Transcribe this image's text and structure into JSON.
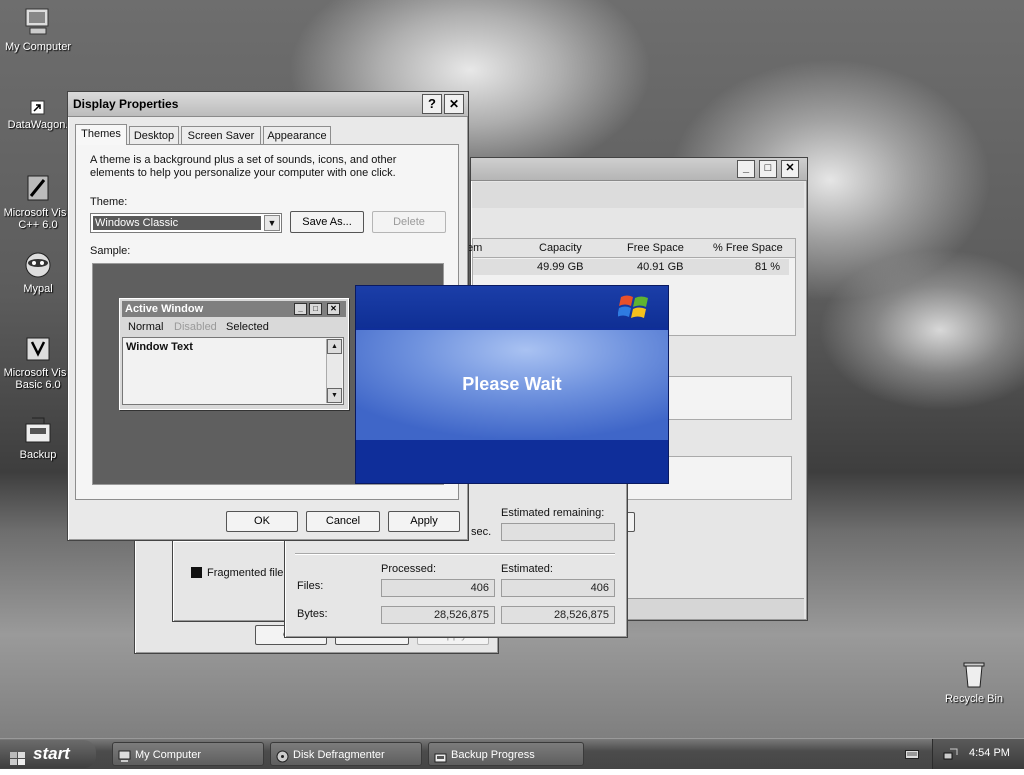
{
  "desktop": {
    "icons": [
      {
        "label": "My Computer",
        "icon": "my-computer-icon"
      },
      {
        "label": "DataWagon.",
        "icon": "shortcut-icon"
      },
      {
        "label": "Microsoft Visu C++ 6.0",
        "icon": "visual-cpp-icon"
      },
      {
        "label": "Mypal",
        "icon": "mypal-icon"
      },
      {
        "label": "Microsoft Visu Basic 6.0",
        "icon": "visual-basic-icon"
      },
      {
        "label": "Backup",
        "icon": "backup-icon"
      },
      {
        "label": "Recycle Bin",
        "icon": "recycle-bin-icon"
      }
    ]
  },
  "display_properties": {
    "title": "Display Properties",
    "help": "?",
    "close": "✕",
    "tabs": [
      "Themes",
      "Desktop",
      "Screen Saver",
      "Appearance"
    ],
    "description": "A theme is a background plus a set of sounds, icons, and other elements to help you personalize your computer with one click.",
    "theme_label": "Theme:",
    "theme_value": "Windows Classic",
    "save_as": "Save As...",
    "delete": "Delete",
    "sample_label": "Sample:",
    "sample": {
      "title": "Active Window",
      "menu": [
        "Normal",
        "Disabled",
        "Selected"
      ],
      "text": "Window Text"
    },
    "ok": "OK",
    "cancel": "Cancel",
    "apply": "Apply"
  },
  "disk_window": {
    "columns": [
      "em",
      "Capacity",
      "Free Space",
      "% Free Space"
    ],
    "row": {
      "capacity": "49.99 GB",
      "free": "40.91 GB",
      "pct": "81 %"
    },
    "legend": "Fragmented file",
    "sec": "sec."
  },
  "backup_progress": {
    "estimated_remaining": "Estimated remaining:",
    "processed": "Processed:",
    "estimated": "Estimated:",
    "files_label": "Files:",
    "files_processed": "406",
    "files_estimated": "406",
    "bytes_label": "Bytes:",
    "bytes_processed": "28,526,875",
    "bytes_estimated": "28,526,875"
  },
  "back_dialog": {
    "ok": "OK",
    "cancel": "Cancel",
    "apply": "Apply"
  },
  "please_wait": {
    "message": "Please Wait"
  },
  "taskbar": {
    "start": "start",
    "tasks": [
      "My Computer",
      "Disk Defragmenter",
      "Backup Progress"
    ],
    "clock": "4:54 PM"
  }
}
